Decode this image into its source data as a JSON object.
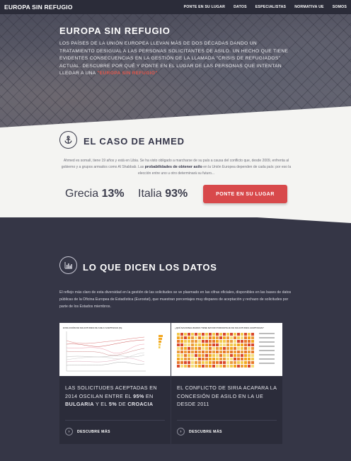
{
  "nav": {
    "brand": "EUROPA SIN REFUGIO",
    "items": [
      "PONTE EN SU LUGAR",
      "DATOS",
      "ESPECIALISTAS",
      "NORMATIVA UE",
      "SOMOS"
    ]
  },
  "hero": {
    "title": "EUROPA SIN REFUGIO",
    "text": "LOS PAÍSES DE LA UNIÓN EUROPEA LLEVAN MÁS DE DOS DÉCADAS DANDO UN TRATAMIENTO DESIGUAL A LAS PERSONAS SOLICITANTES DE ASILO. UN HECHO QUE TIENE EVIDENTES CONSECUENCIAS EN LA GESTIÓN DE LA LLAMADA \"CRISIS DE REFUGIADOS\" ACTUAL. DESCUBRE POR QUÉ Y PONTE EN EL LUGAR DE LAS PERSONAS QUE INTENTAN LLEGAR A UNA",
    "link": "\"EUROPA SIN REFUGIO\""
  },
  "case": {
    "icon": "anchor-icon",
    "title": "EL CASO DE AHMED",
    "text_before": "Ahmed es somalí, tiene 19 años y está en Libia. Se ha visto obligado a marcharse de su país a causa del conflicto que, desde 2009, enfrenta al gobierno y a grupos armados como Al Shabbab. Las ",
    "text_bold": "probabilidades de obtener asilo",
    "text_after": " en la Unión Europea dependen de cada país: por eso la elección entre uno u otro determinará su futuro...",
    "stats": [
      {
        "country": "Grecia",
        "value": "13%"
      },
      {
        "country": "Italia",
        "value": "93%"
      }
    ],
    "cta": "PONTE EN SU LUGAR"
  },
  "datos": {
    "icon": "bar-chart-icon",
    "title": "LO QUE DICEN LOS DATOS",
    "text": "El reflejo más claro de esta diversidad en la gestión de las solicitudes se ve plasmado en las cifras oficiales, disponibles en las bases de datos públicas de la Oficina Europea de Estadística (Eurostat), que muestran porcentajes muy dispares de aceptación y rechazo de solicitudes por parte de los Estados miembros."
  },
  "cards": [
    {
      "thumb_title": "EVOLUCIÓN DE SOLICITUDES DE ASILO ACEPTADAS (%)",
      "p1": "LAS SOLICITUDES ACEPTADAS EN 2014 OSCILAN ENTRE EL ",
      "b1": "95%",
      "p2": " EN ",
      "b2": "BULGARIA",
      "p3": " Y EL ",
      "b3": "5%",
      "p4": " DE ",
      "b4": "CROACIA",
      "more": "DESCUBRE MÁS"
    },
    {
      "thumb_title": "¿QUÉ NACIONALIDADES TIENE MAYOR PORCENTAJE DE SOLICITUDES ACEPTADAS?",
      "text": "EL CONFLICTO DE SIRIA ACAPARA LA CONCESIÓN DE ASILO EN LA UE DESDE 2011",
      "more": "DESCUBRE MÁS"
    }
  ],
  "colors": {
    "accent": "#d8494b",
    "dark": "#353646",
    "light": "#f4f4f2"
  }
}
